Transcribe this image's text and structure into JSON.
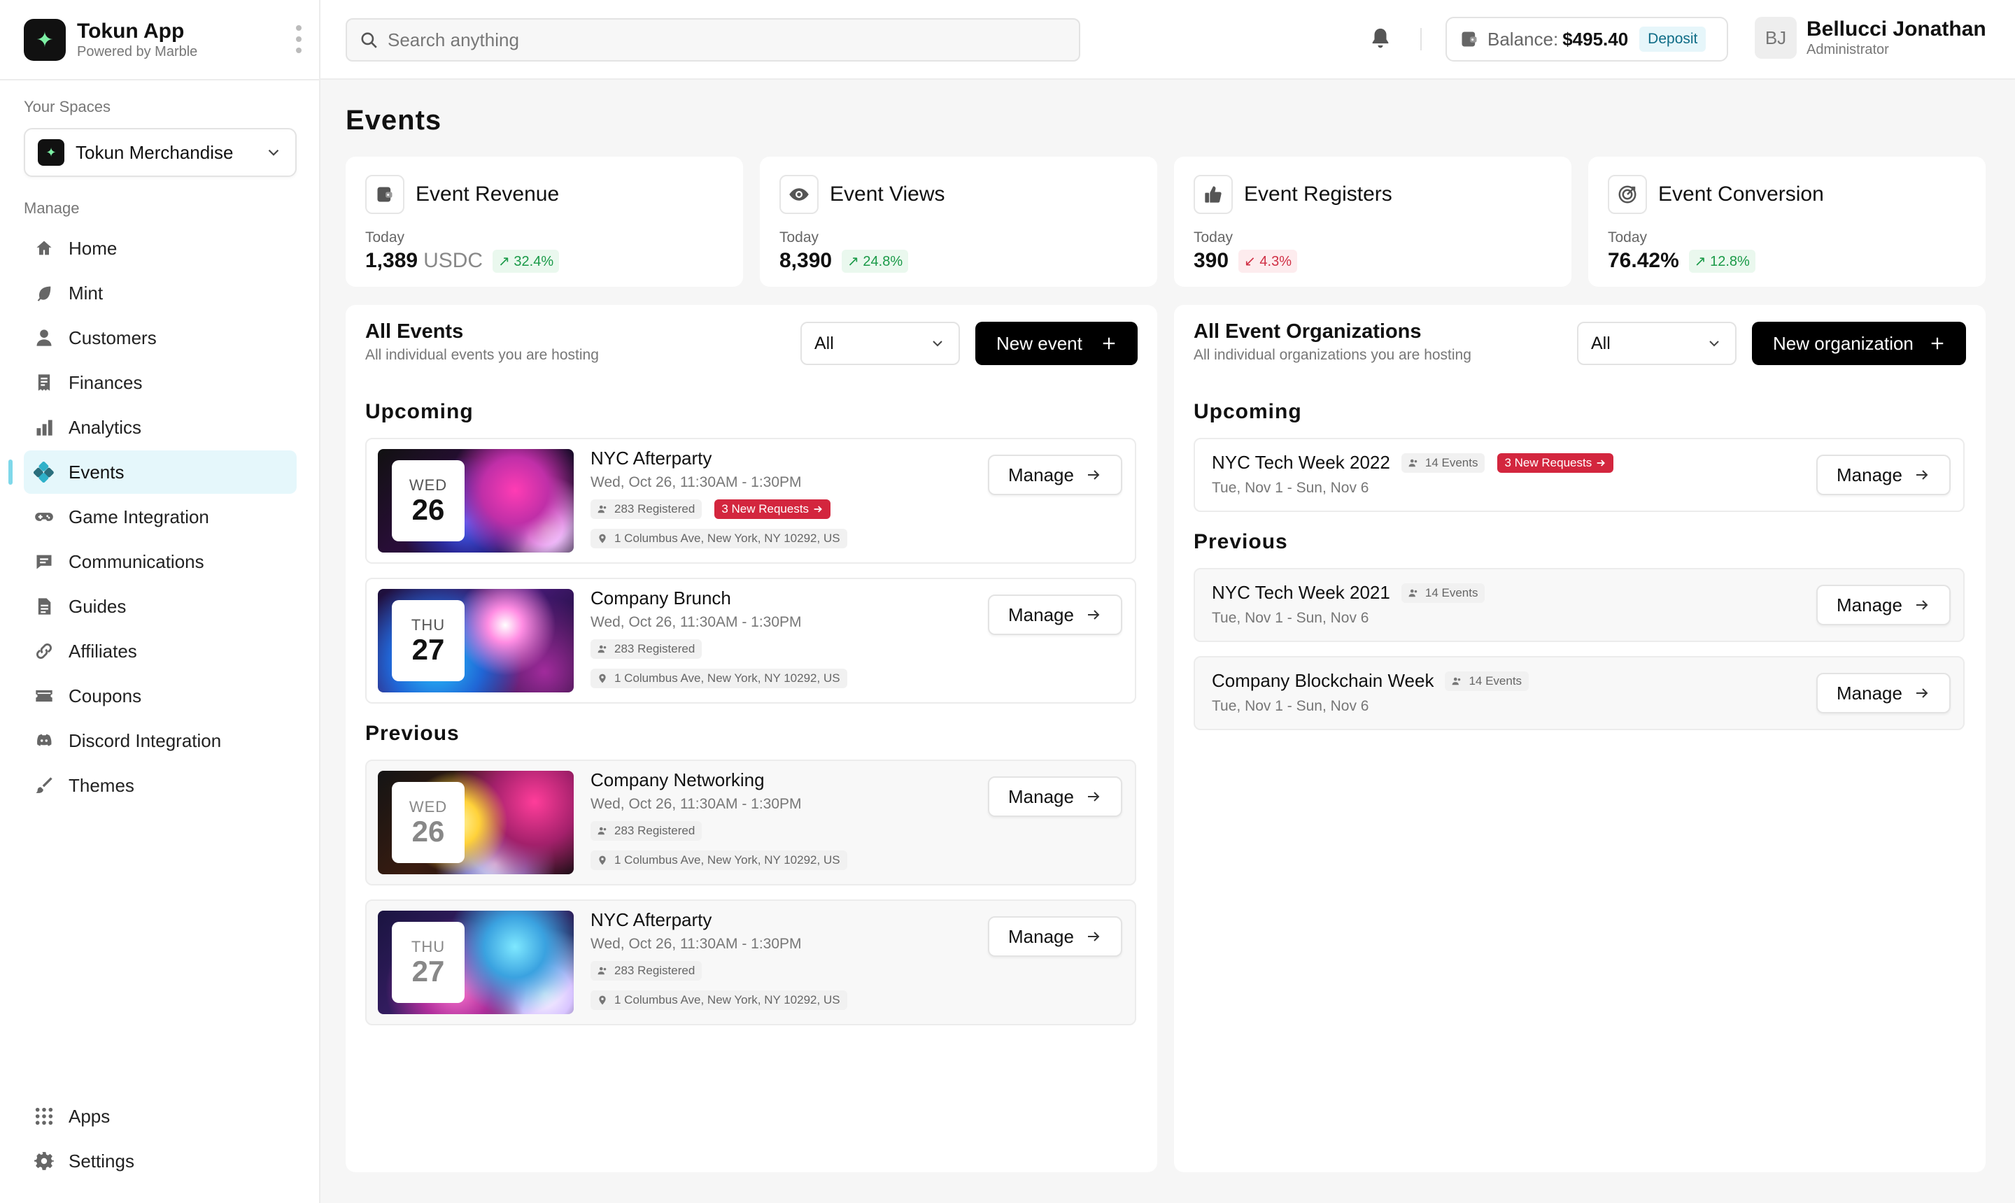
{
  "app": {
    "name": "Tokun App",
    "subtitle": "Powered by Marble"
  },
  "sidebar": {
    "spaces_label": "Your Spaces",
    "space_name": "Tokun Merchandise",
    "manage_label": "Manage",
    "items": [
      {
        "label": "Home",
        "icon": "home-icon"
      },
      {
        "label": "Mint",
        "icon": "leaf-icon"
      },
      {
        "label": "Customers",
        "icon": "user-icon"
      },
      {
        "label": "Finances",
        "icon": "receipt-icon"
      },
      {
        "label": "Analytics",
        "icon": "bar-chart-icon"
      },
      {
        "label": "Events",
        "icon": "events-icon",
        "active": true
      },
      {
        "label": "Game Integration",
        "icon": "gamepad-icon"
      },
      {
        "label": "Communications",
        "icon": "chat-icon"
      },
      {
        "label": "Guides",
        "icon": "document-icon"
      },
      {
        "label": "Affiliates",
        "icon": "link-icon"
      },
      {
        "label": "Coupons",
        "icon": "coupon-icon"
      },
      {
        "label": "Discord Integration",
        "icon": "discord-icon"
      },
      {
        "label": "Themes",
        "icon": "brush-icon"
      }
    ],
    "bottom": [
      {
        "label": "Apps",
        "icon": "grid-icon"
      },
      {
        "label": "Settings",
        "icon": "gear-icon"
      }
    ]
  },
  "topbar": {
    "search_placeholder": "Search anything",
    "balance_label": "Balance:",
    "balance_value": "$495.40",
    "deposit_label": "Deposit",
    "user_initials": "BJ",
    "user_name": "Bellucci Jonathan",
    "user_role": "Administrator"
  },
  "page": {
    "title": "Events"
  },
  "stats": [
    {
      "title": "Event Revenue",
      "today": "Today",
      "value": "1,389",
      "unit": "USDC",
      "delta": "32.4%",
      "trend": "up"
    },
    {
      "title": "Event Views",
      "today": "Today",
      "value": "8,390",
      "unit": "",
      "delta": "24.8%",
      "trend": "up"
    },
    {
      "title": "Event Registers",
      "today": "Today",
      "value": "390",
      "unit": "",
      "delta": "4.3%",
      "trend": "down"
    },
    {
      "title": "Event Conversion",
      "today": "Today",
      "value": "76.42%",
      "unit": "",
      "delta": "12.8%",
      "trend": "up"
    }
  ],
  "events_panel": {
    "title": "All Events",
    "subtitle": "All individual events you are hosting",
    "filter": "All",
    "new_label": "New event",
    "upcoming_label": "Upcoming",
    "previous_label": "Previous",
    "manage_label": "Manage",
    "upcoming": [
      {
        "dow": "WED",
        "day": "26",
        "title": "NYC Afterparty",
        "time": "Wed, Oct 26, 11:30AM - 1:30PM",
        "registered": "283 Registered",
        "requests": "3 New Requests",
        "location": "1 Columbus Ave, New York, NY 10292, US"
      },
      {
        "dow": "THU",
        "day": "27",
        "title": "Company Brunch",
        "time": "Wed, Oct 26, 11:30AM - 1:30PM",
        "registered": "283 Registered",
        "location": "1 Columbus Ave, New York, NY 10292, US"
      }
    ],
    "previous": [
      {
        "dow": "WED",
        "day": "26",
        "title": "Company Networking",
        "time": "Wed, Oct 26, 11:30AM - 1:30PM",
        "registered": "283 Registered",
        "location": "1 Columbus Ave, New York, NY 10292, US"
      },
      {
        "dow": "THU",
        "day": "27",
        "title": "NYC Afterparty",
        "time": "Wed, Oct 26, 11:30AM - 1:30PM",
        "registered": "283 Registered",
        "location": "1 Columbus Ave, New York, NY 10292, US"
      }
    ]
  },
  "orgs_panel": {
    "title": "All Event Organizations",
    "subtitle": "All individual organizations you are hosting",
    "filter": "All",
    "new_label": "New organization",
    "upcoming_label": "Upcoming",
    "previous_label": "Previous",
    "manage_label": "Manage",
    "upcoming": [
      {
        "title": "NYC Tech Week 2022",
        "events": "14 Events",
        "requests": "3 New Requests",
        "dates": "Tue, Nov 1 - Sun, Nov 6"
      }
    ],
    "previous": [
      {
        "title": "NYC Tech Week 2021",
        "events": "14 Events",
        "dates": "Tue, Nov 1 - Sun, Nov 6"
      },
      {
        "title": "Company Blockchain Week",
        "events": "14 Events",
        "dates": "Tue, Nov 1 - Sun, Nov 6"
      }
    ]
  },
  "colors": {
    "accent": "#e5f7fb",
    "danger": "#d3263e",
    "success": "#1a9a48",
    "primary": "#000000"
  }
}
